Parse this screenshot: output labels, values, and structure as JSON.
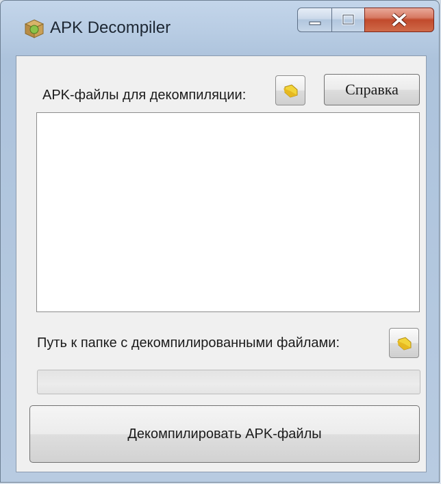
{
  "window": {
    "title": "APK Decompiler"
  },
  "labels": {
    "apk_files": "APK-файлы для декомпиляции:",
    "output_path": "Путь к папке с декомпилированными файлами:"
  },
  "buttons": {
    "help": "Справка",
    "decompile": "Декомпилировать APK-файлы"
  },
  "icons": {
    "app": "package-icon",
    "folder": "folder-open-icon",
    "minimize": "minimize-icon",
    "maximize": "maximize-icon",
    "close": "close-icon"
  },
  "colors": {
    "close_button": "#c14a2c",
    "client_background": "#f0f0f0",
    "folder_icon": "#f2d43a"
  }
}
